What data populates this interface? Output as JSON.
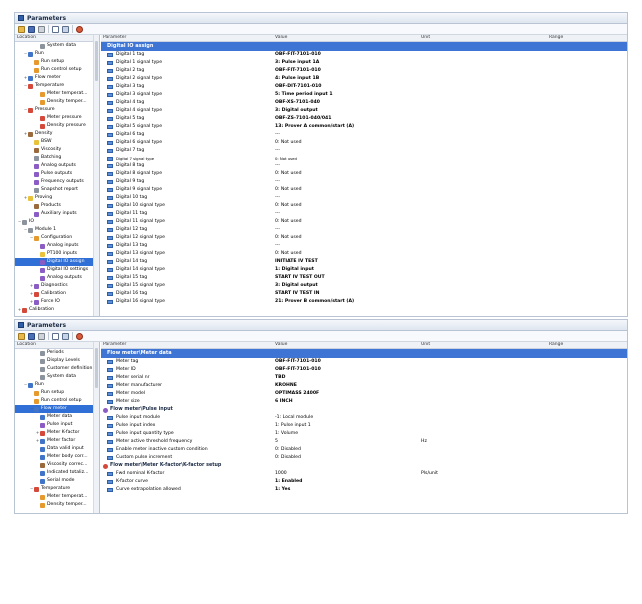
{
  "window1": {
    "title": "Parameters",
    "left_header": "Location",
    "columns": {
      "parameter": "Parameter",
      "value": "Value",
      "unit": "Unit",
      "range": "Range"
    },
    "tree": [
      {
        "indent": 3,
        "exp": "",
        "icon": "c-gray",
        "label": "System data"
      },
      {
        "indent": 1,
        "exp": "−",
        "icon": "c-blue",
        "label": "Run"
      },
      {
        "indent": 2,
        "exp": "",
        "icon": "c-orange",
        "label": "Run setup"
      },
      {
        "indent": 2,
        "exp": "",
        "icon": "c-orange",
        "label": "Run control setup"
      },
      {
        "indent": 1,
        "exp": "+",
        "icon": "c-blue",
        "label": "Flow meter"
      },
      {
        "indent": 1,
        "exp": "−",
        "icon": "c-red",
        "label": "Temperature"
      },
      {
        "indent": 3,
        "exp": "",
        "icon": "c-orange",
        "label": "Meter temperat..."
      },
      {
        "indent": 3,
        "exp": "",
        "icon": "c-orange",
        "label": "Density temper..."
      },
      {
        "indent": 1,
        "exp": "−",
        "icon": "c-red",
        "label": "Pressure"
      },
      {
        "indent": 3,
        "exp": "",
        "icon": "c-red",
        "label": "Meter pressure"
      },
      {
        "indent": 3,
        "exp": "",
        "icon": "c-red",
        "label": "Density pressure"
      },
      {
        "indent": 1,
        "exp": "+",
        "icon": "c-brown",
        "label": "Density"
      },
      {
        "indent": 2,
        "exp": "",
        "icon": "c-yellow",
        "label": "BSW"
      },
      {
        "indent": 2,
        "exp": "",
        "icon": "c-brown",
        "label": "Viscosity"
      },
      {
        "indent": 2,
        "exp": "",
        "icon": "c-gray",
        "label": "Batching"
      },
      {
        "indent": 2,
        "exp": "",
        "icon": "c-purple",
        "label": "Analog outputs"
      },
      {
        "indent": 2,
        "exp": "",
        "icon": "c-purple",
        "label": "Pulse outputs"
      },
      {
        "indent": 2,
        "exp": "",
        "icon": "c-purple",
        "label": "Frequency outputs"
      },
      {
        "indent": 2,
        "exp": "",
        "icon": "c-gray",
        "label": "Snapshot report"
      },
      {
        "indent": 1,
        "exp": "+",
        "icon": "c-yellow",
        "label": "Proving"
      },
      {
        "indent": 2,
        "exp": "",
        "icon": "c-brown",
        "label": "Products"
      },
      {
        "indent": 2,
        "exp": "",
        "icon": "c-purple",
        "label": "Auxiliary inputs"
      },
      {
        "indent": 0,
        "exp": "−",
        "icon": "c-gray",
        "label": "IO"
      },
      {
        "indent": 1,
        "exp": "−",
        "icon": "c-gray",
        "label": "Module 1"
      },
      {
        "indent": 2,
        "exp": "−",
        "icon": "c-orange",
        "label": "Configuration"
      },
      {
        "indent": 3,
        "exp": "",
        "icon": "c-purple",
        "label": "Analog inputs"
      },
      {
        "indent": 3,
        "exp": "",
        "icon": "c-yellow",
        "label": "PT100 inputs"
      },
      {
        "indent": 3,
        "exp": "",
        "icon": "c-purple",
        "label": "Digital IO assign",
        "selected": true
      },
      {
        "indent": 3,
        "exp": "",
        "icon": "c-purple",
        "label": "Digital IO settings"
      },
      {
        "indent": 3,
        "exp": "",
        "icon": "c-purple",
        "label": "Analog outputs"
      },
      {
        "indent": 2,
        "exp": "+",
        "icon": "c-purple",
        "label": "Diagnostics"
      },
      {
        "indent": 2,
        "exp": "+",
        "icon": "c-red",
        "label": "Calibration"
      },
      {
        "indent": 2,
        "exp": "+",
        "icon": "c-purple",
        "label": "Force IO"
      },
      {
        "indent": 0,
        "exp": "+",
        "icon": "c-red",
        "label": "Calibration"
      }
    ],
    "section_title": "Digital IO assign",
    "rows": [
      {
        "p": "Digital 1 tag",
        "v": "OBF-FIT-7101-010"
      },
      {
        "p": "Digital 1 signal type",
        "v": "3: Pulse input 1A"
      },
      {
        "p": "Digital 2 tag",
        "v": "OBF-FIT-7101-010"
      },
      {
        "p": "Digital 2 signal type",
        "v": "4: Pulse input 1B"
      },
      {
        "p": "Digital 3 tag",
        "v": "OBF-DIT-7101-010"
      },
      {
        "p": "Digital 3 signal type",
        "v": "5: Time period input 1"
      },
      {
        "p": "Digital 4 tag",
        "v": "OBF-XS-7101-040"
      },
      {
        "p": "Digital 4 signal type",
        "v": "3: Digital output"
      },
      {
        "p": "Digital 5 tag",
        "v": "OBF-ZS-7101-040/041"
      },
      {
        "p": "Digital 5 signal type",
        "v": "13: Prover A common/start (A)"
      },
      {
        "p": "Digital 6 tag",
        "v": "---",
        "plain": true
      },
      {
        "p": "Digital 6 signal type",
        "v": "0: Not used",
        "plain": true
      },
      {
        "p": "Digital 7 tag",
        "v": "---",
        "plain": true
      },
      {
        "p": "Digital 7 signal type",
        "v": "0: Not used",
        "plain": true,
        "small": true
      },
      {
        "p": "Digital 8 tag",
        "v": "---",
        "plain": true
      },
      {
        "p": "Digital 8 signal type",
        "v": "0: Not used",
        "plain": true
      },
      {
        "p": "Digital 9 tag",
        "v": "---",
        "plain": true
      },
      {
        "p": "Digital 9 signal type",
        "v": "0: Not used",
        "plain": true
      },
      {
        "p": "Digital 10 tag",
        "v": "---",
        "plain": true
      },
      {
        "p": "Digital 10 signal type",
        "v": "0: Not used",
        "plain": true
      },
      {
        "p": "Digital 11 tag",
        "v": "---",
        "plain": true
      },
      {
        "p": "Digital 11 signal type",
        "v": "0: Not used",
        "plain": true
      },
      {
        "p": "Digital 12 tag",
        "v": "---",
        "plain": true
      },
      {
        "p": "Digital 12 signal type",
        "v": "0: Not used",
        "plain": true
      },
      {
        "p": "Digital 13 tag",
        "v": "---",
        "plain": true
      },
      {
        "p": "Digital 13 signal type",
        "v": "0: Not used",
        "plain": true
      },
      {
        "p": "Digital 14 tag",
        "v": "INITIATE IV TEST"
      },
      {
        "p": "Digital 14 signal type",
        "v": "1: Digital input"
      },
      {
        "p": "Digital 15 tag",
        "v": "START IV TEST OUT"
      },
      {
        "p": "Digital 15 signal type",
        "v": "3: Digital output"
      },
      {
        "p": "Digital 16 tag",
        "v": "START IV TEST IN"
      },
      {
        "p": "Digital 16 signal type",
        "v": "21: Prover B common/start (A)"
      }
    ]
  },
  "window2": {
    "title": "Parameters",
    "left_header": "Location",
    "columns": {
      "parameter": "Parameter",
      "value": "Value",
      "unit": "Unit",
      "range": "Range"
    },
    "tree": [
      {
        "indent": 3,
        "exp": "",
        "icon": "c-gray",
        "label": "Periods"
      },
      {
        "indent": 3,
        "exp": "",
        "icon": "c-gray",
        "label": "Display Levels"
      },
      {
        "indent": 3,
        "exp": "",
        "icon": "c-gray",
        "label": "Customer definition"
      },
      {
        "indent": 3,
        "exp": "",
        "icon": "c-gray",
        "label": "System data"
      },
      {
        "indent": 1,
        "exp": "−",
        "icon": "c-blue",
        "label": "Run"
      },
      {
        "indent": 2,
        "exp": "",
        "icon": "c-orange",
        "label": "Run setup"
      },
      {
        "indent": 2,
        "exp": "",
        "icon": "c-orange",
        "label": "Run control setup"
      },
      {
        "indent": 2,
        "exp": "−",
        "icon": "c-blue",
        "label": "Flow meter",
        "selected": true
      },
      {
        "indent": 3,
        "exp": "",
        "icon": "c-blue",
        "label": "Meter data"
      },
      {
        "indent": 3,
        "exp": "",
        "icon": "c-purple",
        "label": "Pulse input"
      },
      {
        "indent": 3,
        "exp": "+",
        "icon": "c-red",
        "label": "Meter K-factor"
      },
      {
        "indent": 3,
        "exp": "+",
        "icon": "c-blue",
        "label": "Meter factor"
      },
      {
        "indent": 3,
        "exp": "",
        "icon": "c-blue",
        "label": "Data valid input"
      },
      {
        "indent": 3,
        "exp": "",
        "icon": "c-blue",
        "label": "Meter body corr..."
      },
      {
        "indent": 3,
        "exp": "",
        "icon": "c-brown",
        "label": "Viscosity correc..."
      },
      {
        "indent": 3,
        "exp": "",
        "icon": "c-blue",
        "label": "Indicated totaliz..."
      },
      {
        "indent": 3,
        "exp": "",
        "icon": "c-blue",
        "label": "Serial mode"
      },
      {
        "indent": 2,
        "exp": "−",
        "icon": "c-red",
        "label": "Temperature"
      },
      {
        "indent": 3,
        "exp": "",
        "icon": "c-orange",
        "label": "Meter temperat..."
      },
      {
        "indent": 3,
        "exp": "",
        "icon": "c-orange",
        "label": "Density temper..."
      }
    ],
    "section_title": "Flow meter\\Meter data",
    "meter_rows": [
      {
        "p": "Meter tag",
        "v": "OBF-FIT-7101-010",
        "u": ""
      },
      {
        "p": "Meter ID",
        "v": "OBF-FIT-7101-010",
        "u": ""
      },
      {
        "p": "Meter serial nr",
        "v": "TBD",
        "u": ""
      },
      {
        "p": "Meter manufacturer",
        "v": "KROHNE",
        "u": ""
      },
      {
        "p": "Meter model",
        "v": "OPTIMASS 2400F",
        "u": ""
      },
      {
        "p": "Meter size",
        "v": "6 INCH",
        "u": ""
      }
    ],
    "pulse_title": "Flow meter\\Pulse input",
    "pulse_rows": [
      {
        "p": "Pulse input module",
        "v": "-1: Local module",
        "u": "",
        "plain": true
      },
      {
        "p": "Pulse input index",
        "v": "1: Pulse input 1",
        "u": "",
        "plain": true
      },
      {
        "p": "Pulse input quantity type",
        "v": "1: Volume",
        "u": "",
        "plain": true
      },
      {
        "p": "Meter active threshold frequency",
        "v": "5",
        "u": "Hz",
        "plain": true
      },
      {
        "p": "Enable meter inactive custom condition",
        "v": "0: Disabled",
        "u": "",
        "plain": true
      },
      {
        "p": "Custom pulse increment",
        "v": "0: Disabled",
        "u": "",
        "plain": true
      }
    ],
    "kfactor_title": "Flow meter\\Meter K-factor\\K-factor setup",
    "kfactor_rows": [
      {
        "p": "Fwd nominal K-factor",
        "v": "1000",
        "u": "Pls/unit",
        "plain": true
      },
      {
        "p": "K-factor curve",
        "v": "1: Enabled",
        "u": ""
      },
      {
        "p": "Curve extrapolation allowed",
        "v": "1: Yes",
        "u": ""
      }
    ]
  }
}
